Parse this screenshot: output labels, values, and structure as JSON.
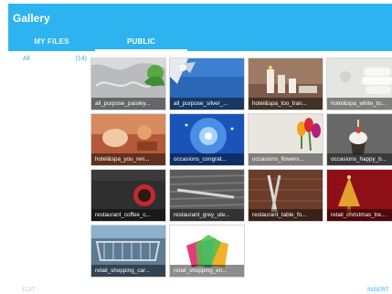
{
  "header": {
    "title": "Gallery"
  },
  "tabs": [
    {
      "label": "MY FILES"
    },
    {
      "label": "PUBLIC"
    }
  ],
  "sidebar": {
    "items": [
      {
        "label": "All",
        "count": "(14)"
      }
    ]
  },
  "gallery": {
    "tiles": [
      {
        "caption": "all_purpose_paisley...",
        "icon": "paisley-image"
      },
      {
        "caption": "all_purpose_silver_...",
        "icon": "silver-ribbon-image"
      },
      {
        "caption": "hotel&spa_too_tran...",
        "icon": "spa-candles-image"
      },
      {
        "caption": "hotel&spa_white_to...",
        "icon": "spa-towels-image"
      },
      {
        "caption": "hotel&spa_you_ren...",
        "icon": "spa-treatment-image"
      },
      {
        "caption": "occasions_congrat...",
        "icon": "blue-sparkle-image"
      },
      {
        "caption": "occasions_flowers...",
        "icon": "tulips-image"
      },
      {
        "caption": "occasions_happy_b...",
        "icon": "cupcake-image"
      },
      {
        "caption": "restaurant_coffee_c...",
        "icon": "coffee-cup-image"
      },
      {
        "caption": "restaurant_grey_ute...",
        "icon": "utensils-image"
      },
      {
        "caption": "restaurant_table_fo...",
        "icon": "table-fork-image"
      },
      {
        "caption": "retail_christmas_tre...",
        "icon": "christmas-tree-image"
      },
      {
        "caption": "retail_shopping_car...",
        "icon": "shopping-carts-image"
      },
      {
        "caption": "retail_shopping_en...",
        "icon": "shopping-bags-image"
      }
    ]
  },
  "footer": {
    "edit_label": "EDIT",
    "insert_label": "INSERT"
  }
}
